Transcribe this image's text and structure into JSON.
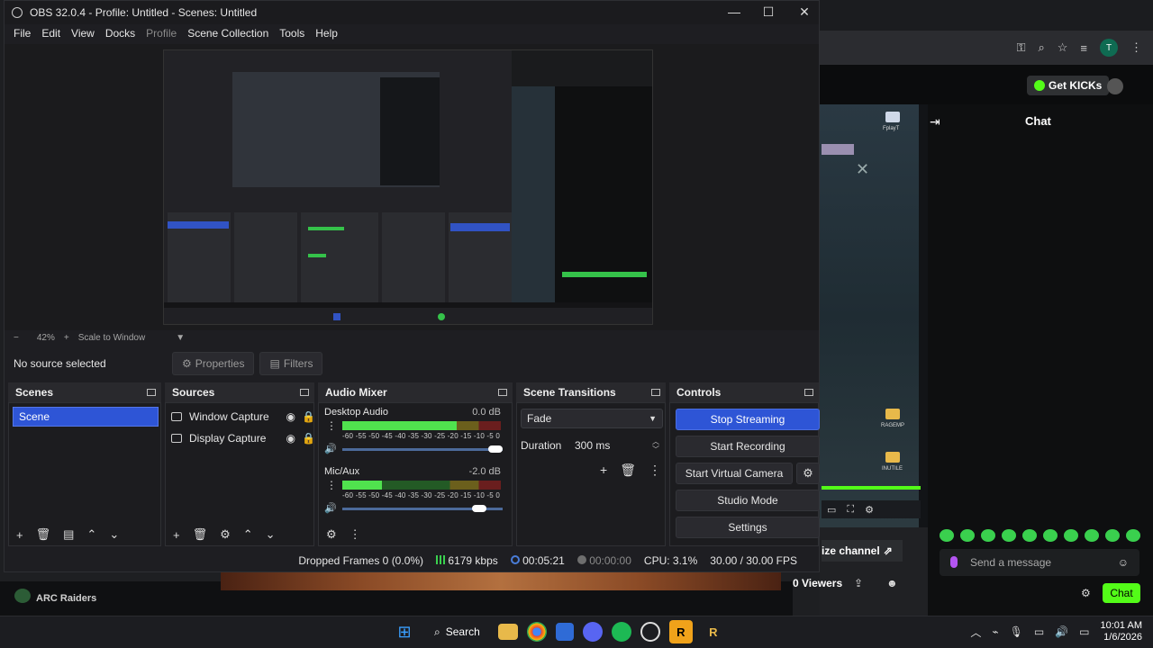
{
  "window": {
    "title": "OBS 32.0.4 - Profile: Untitled - Scenes: Untitled"
  },
  "menu": [
    "File",
    "Edit",
    "View",
    "Docks",
    "Profile",
    "Scene Collection",
    "Tools",
    "Help"
  ],
  "zoom": {
    "minus": "−",
    "level": "42%",
    "plus": "+",
    "mode": "Scale to Window"
  },
  "source_bar": {
    "no_source": "No source selected",
    "properties": "Properties",
    "filters": "Filters"
  },
  "docks": {
    "scenes": {
      "title": "Scenes",
      "items": [
        "Scene"
      ]
    },
    "sources": {
      "title": "Sources",
      "items": [
        "Window Capture",
        "Display Capture"
      ]
    },
    "audio_mixer": {
      "title": "Audio Mixer",
      "scale": "-60 -55 -50 -45 -40 -35 -30 -25 -20 -15 -10 -5 0",
      "channels": [
        {
          "name": "Desktop Audio",
          "db": "0.0 dB",
          "level": 0.72,
          "volume": 1.0
        },
        {
          "name": "Mic/Aux",
          "db": "-2.0 dB",
          "level": 0.25,
          "volume": 0.9
        }
      ]
    },
    "transitions": {
      "title": "Scene Transitions",
      "selected": "Fade",
      "duration_label": "Duration",
      "duration_value": "300 ms"
    },
    "controls": {
      "title": "Controls",
      "stop_streaming": "Stop Streaming",
      "start_recording": "Start Recording",
      "start_virtual_camera": "Start Virtual Camera",
      "studio_mode": "Studio Mode",
      "settings": "Settings"
    }
  },
  "status": {
    "dropped_frames": "Dropped Frames 0 (0.0%)",
    "bitrate": "6179 kbps",
    "live_time": "00:05:21",
    "rec_time": "00:00:00",
    "cpu": "CPU: 3.1%",
    "fps": "30.00 / 30.00 FPS"
  },
  "background": {
    "get_kicks": "Get KICKs",
    "chat_title": "Chat",
    "send_placeholder": "Send a message",
    "chat_button": "Chat",
    "viewers": "0 Viewers",
    "customize": "ize channel",
    "game": "ARC Raiders",
    "avatar_letter": "T",
    "folder1": "RAGEMP",
    "folder2": "INUTILE",
    "folder3": "FplayT"
  },
  "taskbar": {
    "search": "Search",
    "time": "10:01 AM",
    "date": "1/6/2026"
  }
}
